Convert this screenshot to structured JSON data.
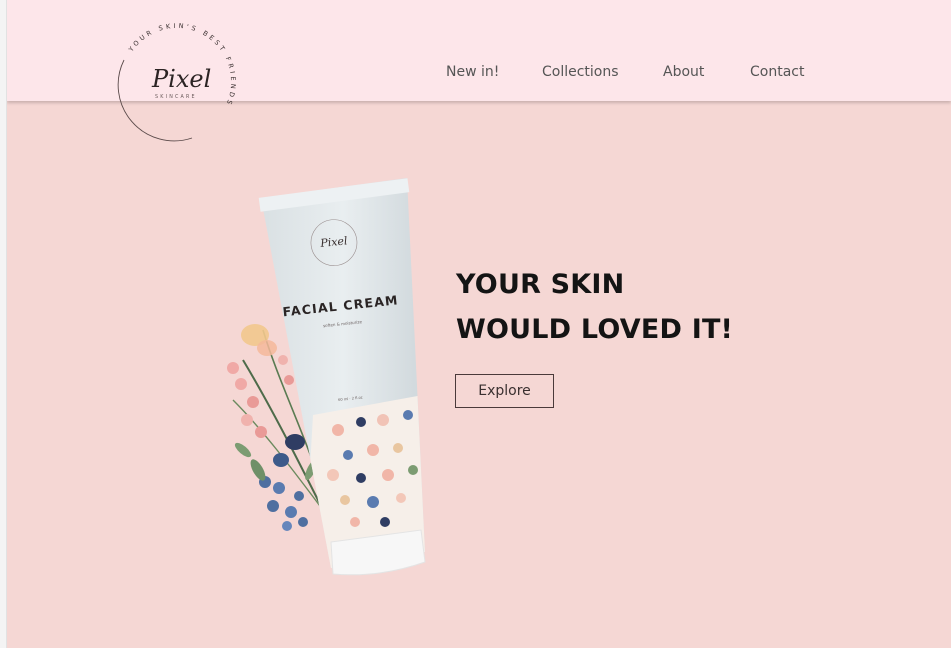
{
  "brand": {
    "name": "Pixel",
    "sub": "SKINCARE",
    "tagline": "YOUR SKIN'S BEST FRIENDS"
  },
  "nav": {
    "items": [
      {
        "label": "New in!"
      },
      {
        "label": "Collections"
      },
      {
        "label": "About"
      },
      {
        "label": "Contact"
      }
    ]
  },
  "hero": {
    "headline_line1": "YOUR SKIN",
    "headline_line2": "WOULD LOVED IT!",
    "cta_label": "Explore"
  },
  "product": {
    "name": "FACIAL CREAM",
    "subtitle": "soften & moisturize",
    "volume": "60 ml · 2 fl.oz",
    "brand": "Pixel"
  },
  "colors": {
    "header_bg": "#fde6ea",
    "page_bg": "#f5d7d4",
    "text_dark": "#141414",
    "nav_text": "#555555"
  }
}
